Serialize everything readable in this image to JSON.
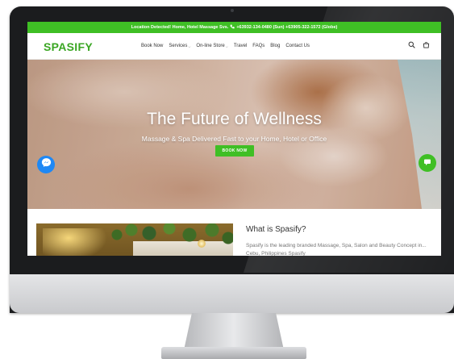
{
  "announcement": {
    "text": "Location Detected! Home, Hotel Massage Svs.",
    "phone_icon": "phone-icon",
    "phones": "+63932-134-0480 (Sun) +63905-322-1572 (Globe)"
  },
  "nav": {
    "logo": "SPASIFY",
    "items": [
      {
        "label": "Book Now",
        "has_dropdown": false
      },
      {
        "label": "Services",
        "has_dropdown": true
      },
      {
        "label": "On-line Store",
        "has_dropdown": true
      },
      {
        "label": "Travel",
        "has_dropdown": false
      },
      {
        "label": "FAQs",
        "has_dropdown": false
      },
      {
        "label": "Blog",
        "has_dropdown": false
      },
      {
        "label": "Contact Us",
        "has_dropdown": false
      }
    ],
    "icons": [
      "search-icon",
      "cart-icon"
    ]
  },
  "hero": {
    "title": "The Future of Wellness",
    "subtitle": "Massage & Spa Delivered Fast to your Home, Hotel or Office",
    "button": "BOOK NOW"
  },
  "floating": {
    "left_icon": "messenger-icon",
    "right_icon": "chat-icon"
  },
  "about": {
    "title": "What is Spasify?",
    "body": "Spasify is the leading branded Massage, Spa, Salon and Beauty Concept in... Cebu, Philippines Spasify"
  },
  "colors": {
    "brand_green": "#3fbf25",
    "logo_green": "#3aa623",
    "messenger_blue": "#1e88f5"
  }
}
